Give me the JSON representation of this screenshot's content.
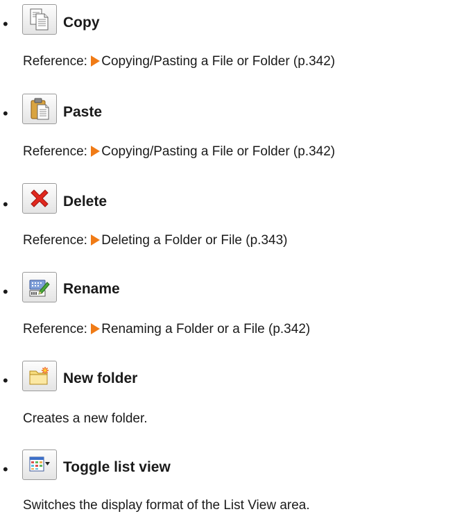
{
  "items": [
    {
      "icon": "copy-icon",
      "title": "Copy",
      "ref_prefix": "Reference: ",
      "ref_link": "Copying/Pasting a File or Folder (p.342)"
    },
    {
      "icon": "paste-icon",
      "title": "Paste",
      "ref_prefix": "Reference: ",
      "ref_link": "Copying/Pasting a File or Folder (p.342)"
    },
    {
      "icon": "delete-icon",
      "title": "Delete",
      "ref_prefix": "Reference: ",
      "ref_link": "Deleting a Folder or File (p.343)"
    },
    {
      "icon": "rename-icon",
      "title": "Rename",
      "ref_prefix": "Reference: ",
      "ref_link": "Renaming a Folder or a File (p.342)"
    },
    {
      "icon": "new-folder-icon",
      "title": "New folder",
      "description": "Creates a new folder."
    },
    {
      "icon": "toggle-list-view-icon",
      "title": "Toggle list view",
      "description": "Switches the display format of the List View area."
    }
  ],
  "bullet": "•",
  "colors": {
    "link_arrow": "#f07b16",
    "delete_red": "#e0281e",
    "text": "#1a1a1a"
  }
}
